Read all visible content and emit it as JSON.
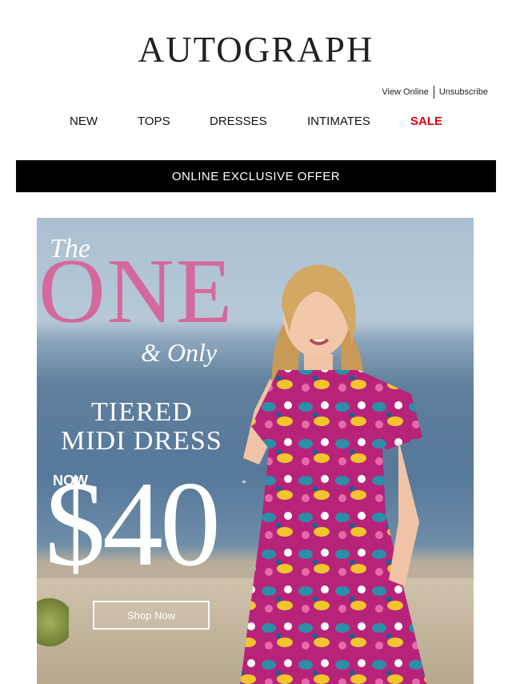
{
  "brand": {
    "logo_text": "AUTOGRAPH"
  },
  "utility_links": {
    "view_online": "View Online",
    "unsubscribe": "Unsubscribe"
  },
  "nav": {
    "items": [
      {
        "label": "NEW"
      },
      {
        "label": "TOPS"
      },
      {
        "label": "DRESSES"
      },
      {
        "label": "INTIMATES"
      },
      {
        "label": "SALE"
      }
    ]
  },
  "colors": {
    "sale": "#e3000f",
    "accent_pink": "#d4699e",
    "offer_bar": "#000000"
  },
  "offer_bar": {
    "label": "ONLINE EXCLUSIVE OFFER"
  },
  "hero": {
    "line_the": "The",
    "line_one": "ONE",
    "line_only": "& Only",
    "line_tiered": "TIERED",
    "line_midi": "MIDI DRESS",
    "now_label": "NOW",
    "price": "$40",
    "price_marker": "*",
    "cta_label": "Shop Now"
  }
}
